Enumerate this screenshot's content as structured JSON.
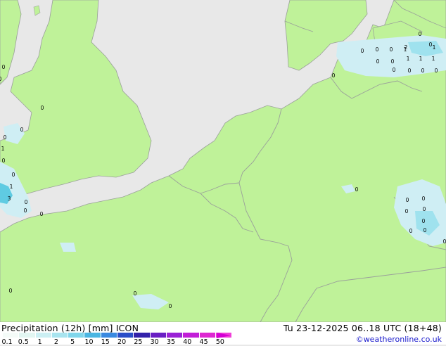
{
  "title": "Precipitation (12h) [mm] ICON",
  "datetime": "Tu 23-12-2025 06..18 UTC (18+48)",
  "credit": "©weatheronline.co.uk",
  "colors": {
    "land": "#bff299",
    "sea": "#e8e8e8",
    "border": "#9aa09a",
    "precip_light": "#cfeef4",
    "precip_mid": "#9fe2ee",
    "precip_strong": "#5fcbe2"
  },
  "legend": {
    "labels": [
      "0.1",
      "0.5",
      "1",
      "2",
      "5",
      "10",
      "15",
      "20",
      "25",
      "30",
      "35",
      "40",
      "45",
      "50"
    ],
    "colors": [
      "#f4fbf8",
      "#e2f6f2",
      "#cbeff3",
      "#a8e4ef",
      "#80d6eb",
      "#4ab6e2",
      "#3a8ae0",
      "#2a4ec8",
      "#3322aa",
      "#6a1fc4",
      "#9a22d6",
      "#c21ed8",
      "#de28d2",
      "#f040d8"
    ]
  },
  "station_values": [
    {
      "label": "0",
      "id": "w1"
    },
    {
      "label": "0",
      "id": "w2"
    },
    {
      "label": "0",
      "id": "w3"
    },
    {
      "label": "0",
      "id": "w4"
    },
    {
      "label": "0",
      "id": "w5"
    },
    {
      "label": "1",
      "id": "w6"
    },
    {
      "label": "0",
      "id": "w7"
    },
    {
      "label": "1",
      "id": "w8"
    },
    {
      "label": "3",
      "id": "w9"
    },
    {
      "label": "0",
      "id": "w10"
    },
    {
      "label": "0",
      "id": "w11"
    },
    {
      "label": "0",
      "id": "w12"
    },
    {
      "label": "0",
      "id": "w13"
    },
    {
      "label": "0",
      "id": "w14"
    },
    {
      "label": "0",
      "id": "s1"
    },
    {
      "label": "0",
      "id": "s2"
    },
    {
      "label": "0",
      "id": "d1"
    },
    {
      "label": "0",
      "id": "d2"
    },
    {
      "label": "0",
      "id": "d3"
    },
    {
      "label": "0",
      "id": "d4"
    },
    {
      "label": "1",
      "id": "d5"
    },
    {
      "label": "0",
      "id": "d6"
    },
    {
      "label": "2",
      "id": "d7"
    },
    {
      "label": "1",
      "id": "d8"
    },
    {
      "label": "0",
      "id": "d9"
    },
    {
      "label": "0",
      "id": "d10"
    },
    {
      "label": "1",
      "id": "d11"
    },
    {
      "label": "1",
      "id": "d12"
    },
    {
      "label": "0",
      "id": "d13"
    },
    {
      "label": "0",
      "id": "d14"
    },
    {
      "label": "0",
      "id": "d15"
    },
    {
      "label": "1",
      "id": "d16"
    },
    {
      "label": "0",
      "id": "d17"
    },
    {
      "label": "0",
      "id": "d18"
    },
    {
      "label": "0",
      "id": "e1"
    },
    {
      "label": "0",
      "id": "e2"
    },
    {
      "label": "0",
      "id": "e3"
    },
    {
      "label": "0",
      "id": "e4"
    },
    {
      "label": "0",
      "id": "e5"
    },
    {
      "label": "0",
      "id": "e6"
    },
    {
      "label": "0",
      "id": "e7"
    },
    {
      "label": "0",
      "id": "e8"
    },
    {
      "label": "0",
      "id": "e9"
    }
  ]
}
